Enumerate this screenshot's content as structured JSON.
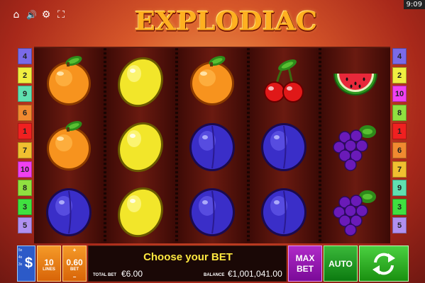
{
  "status_bar": {
    "time": "9:09"
  },
  "top_icons": [
    {
      "name": "home-icon",
      "glyph": "⌂"
    },
    {
      "name": "sound-icon",
      "glyph": "🔊"
    },
    {
      "name": "gear-icon",
      "glyph": "⚙"
    },
    {
      "name": "fullscreen-icon",
      "glyph": "⛶"
    }
  ],
  "game": {
    "title": "EXPLODIAC"
  },
  "paylines_left": [
    {
      "n": "4",
      "color": "#7a6ae8"
    },
    {
      "n": "2",
      "color": "#f0ee40"
    },
    {
      "n": "9",
      "color": "#60e0b0"
    },
    {
      "n": "6",
      "color": "#f08a30"
    },
    {
      "n": "1",
      "color": "#f02020"
    },
    {
      "n": "7",
      "color": "#f0c030"
    },
    {
      "n": "10",
      "color": "#f040f0"
    },
    {
      "n": "8",
      "color": "#90e040"
    },
    {
      "n": "3",
      "color": "#40e040"
    },
    {
      "n": "5",
      "color": "#b090f0"
    }
  ],
  "paylines_right": [
    {
      "n": "4",
      "color": "#7a6ae8"
    },
    {
      "n": "2",
      "color": "#f0ee40"
    },
    {
      "n": "10",
      "color": "#f040f0"
    },
    {
      "n": "8",
      "color": "#90e040"
    },
    {
      "n": "1",
      "color": "#f02020"
    },
    {
      "n": "6",
      "color": "#f08a30"
    },
    {
      "n": "7",
      "color": "#f0c030"
    },
    {
      "n": "9",
      "color": "#60e0b0"
    },
    {
      "n": "3",
      "color": "#40e040"
    },
    {
      "n": "5",
      "color": "#b090f0"
    }
  ],
  "reels": [
    [
      "orange",
      "orange",
      "plum"
    ],
    [
      "lemon",
      "lemon",
      "lemon"
    ],
    [
      "orange",
      "plum",
      "plum"
    ],
    [
      "cherry",
      "plum",
      "plum"
    ],
    [
      "watermelon",
      "grapes",
      "grapes"
    ]
  ],
  "bet_panel": {
    "ways_lines": [
      "5x",
      "4x",
      "3x"
    ],
    "ways_symbol": "$",
    "lines_value": "10",
    "lines_label": "LINES",
    "bet_value": "0.60",
    "bet_label": "BET",
    "bet_plus": "+",
    "bet_minus": "−",
    "message": "Choose your BET",
    "total_bet_label": "TOTAL BET",
    "total_bet_value": "€6.00",
    "balance_label": "BALANCE",
    "balance_value": "€1,001,041.00",
    "max_bet_line1": "MAX",
    "max_bet_line2": "BET",
    "auto_label": "AUTO"
  }
}
